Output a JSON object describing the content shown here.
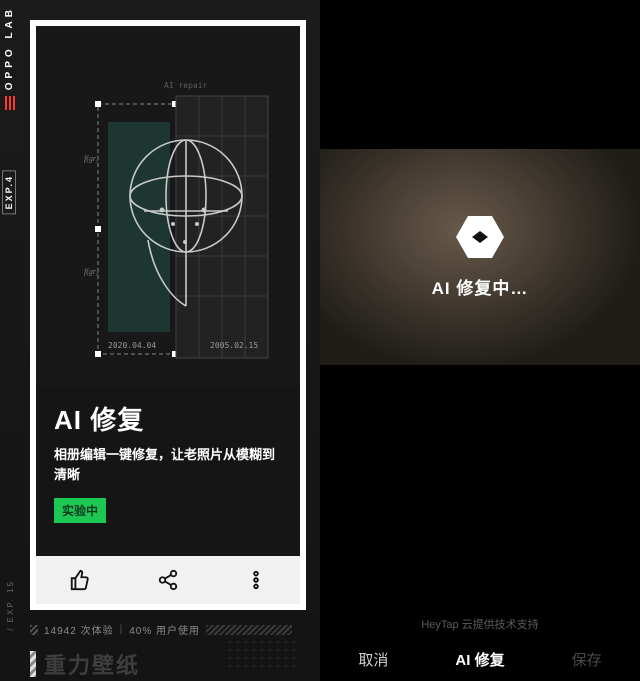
{
  "left": {
    "brand": "OPPO LAB",
    "exp_chip": "EXP.4",
    "exp_side": "/ EXP. 15",
    "illu": {
      "label_top": "AI repair",
      "notation_1": "f(gr)",
      "notation_2": "f(gr)",
      "date_left": "2020.04.04",
      "date_right": "2005.02.15"
    },
    "card": {
      "title": "AI 修复",
      "subtitle": "相册编辑一键修复，让老照片从模糊到清晰",
      "badge": "实验中"
    },
    "stats": {
      "plays": "14942 次体验",
      "users": "40% 用户使用"
    },
    "next_title": "重力壁纸"
  },
  "right": {
    "loading": "AI 修复中…",
    "powered_by": "HeyTap 云提供技术支持",
    "bottom": {
      "cancel": "取消",
      "action": "AI 修复",
      "save": "保存"
    }
  }
}
